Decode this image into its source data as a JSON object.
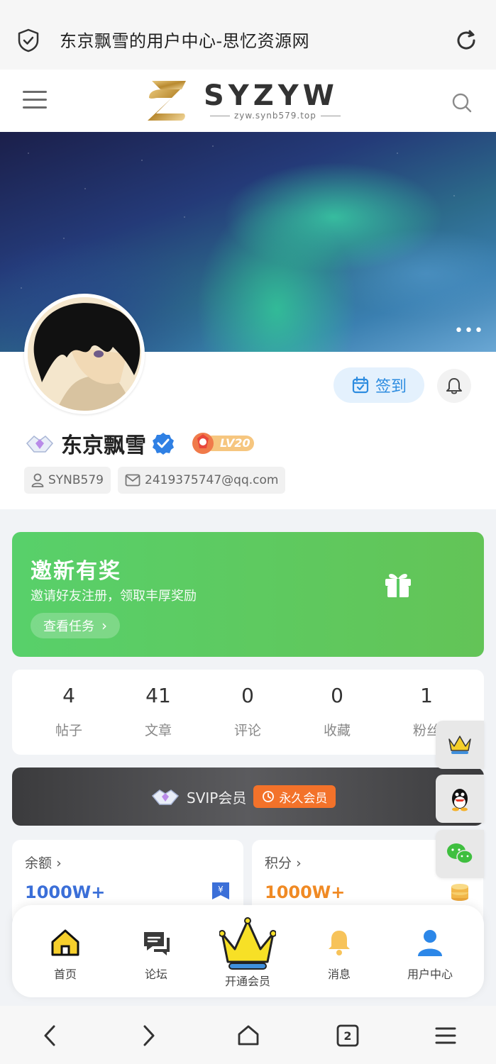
{
  "browser": {
    "tab_title": "东京飘雪的用户中心-思忆资源网",
    "tabs_count": "2"
  },
  "header": {
    "logo_text": "SYZYW",
    "logo_subtitle": "zyw.synb579.top"
  },
  "profile": {
    "username": "东京飘雪",
    "level": "LV20",
    "signin_label": "签到",
    "user_id": "SYNB579",
    "email": "2419375747@qq.com"
  },
  "invite": {
    "title": "邀新有奖",
    "subtitle": "邀请好友注册，领取丰厚奖励",
    "button": "查看任务"
  },
  "stats": [
    {
      "value": "4",
      "label": "帖子"
    },
    {
      "value": "41",
      "label": "文章"
    },
    {
      "value": "0",
      "label": "评论"
    },
    {
      "value": "0",
      "label": "收藏"
    },
    {
      "value": "1",
      "label": "粉丝"
    }
  ],
  "membership": {
    "label": "SVIP会员",
    "tag": "永久会员"
  },
  "wallet": {
    "balance_label": "余额",
    "balance_value": "1000W+",
    "points_label": "积分",
    "points_value": "1000W+"
  },
  "tabbar": [
    {
      "label": "首页"
    },
    {
      "label": "论坛"
    },
    {
      "label": "开通会员"
    },
    {
      "label": "消息"
    },
    {
      "label": "用户中心"
    }
  ],
  "colors": {
    "accent_blue": "#2d8ce0",
    "invite_green": "#5bcb63",
    "vip_orange": "#f3722a",
    "balance_blue": "#3b6fd8",
    "points_orange": "#f08a24"
  }
}
